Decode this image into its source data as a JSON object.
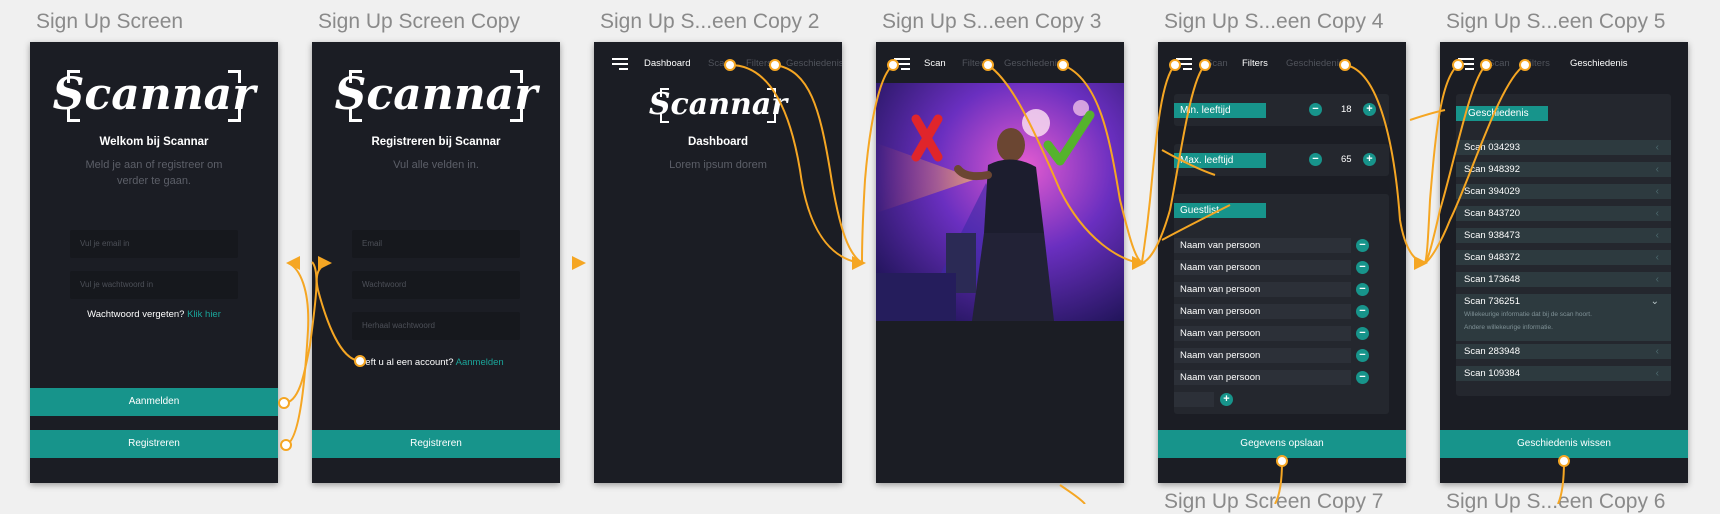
{
  "frames": [
    {
      "title": "Sign Up Screen"
    },
    {
      "title": "Sign Up Screen Copy"
    },
    {
      "title": "Sign Up S...een Copy 2"
    },
    {
      "title": "Sign Up S...een Copy 3"
    },
    {
      "title": "Sign Up S...een Copy 4"
    },
    {
      "title": "Sign Up S...een Copy 5"
    }
  ],
  "bottom_titles": [
    "Sign Up Screen Copy 7",
    "Sign Up S...een Copy 6"
  ],
  "logo_text": "Scannar",
  "login": {
    "heading": "Welkom bij Scannar",
    "subtitle": "Meld je aan of registreer om verder te gaan.",
    "email_placeholder": "Vul je email in",
    "password_placeholder": "Vul je wachtwoord in",
    "forgot_text": "Wachtwoord vergeten?",
    "forgot_link": "Klik hier",
    "login_button": "Aanmelden",
    "register_button": "Registreren"
  },
  "register": {
    "heading": "Registreren bij Scannar",
    "subtitle": "Vul alle velden in.",
    "email_placeholder": "Email",
    "password_placeholder": "Wachtwoord",
    "repeat_placeholder": "Herhaal wachtwoord",
    "account_text": "eeft u al een account?",
    "account_link": "Aanmelden",
    "register_button": "Registreren"
  },
  "dashboard": {
    "nav": [
      "Dashboard",
      "Scan",
      "Filters",
      "Geschiedenis"
    ],
    "heading": "Dashboard",
    "subtitle": "Lorem ipsum dorem"
  },
  "scan": {
    "nav": [
      "Scan",
      "Filters",
      "Geschiedenis"
    ]
  },
  "filters": {
    "nav": [
      "Scan",
      "Filters",
      "Geschiedenis"
    ],
    "min_label": "Min. leeftijd",
    "min_value": "18",
    "max_label": "Max. leeftijd",
    "max_value": "65",
    "guestlist_label": "Guestlist",
    "guests": [
      "Naam van persoon",
      "Naam van persoon",
      "Naam van persoon",
      "Naam van persoon",
      "Naam van persoon",
      "Naam van persoon",
      "Naam van persoon"
    ],
    "save_button": "Gegevens opslaan"
  },
  "history": {
    "nav": [
      "Scan",
      "Filters",
      "Geschiedenis"
    ],
    "label": "Geschiedenis",
    "scans": [
      "Scan 034293",
      "Scan 948392",
      "Scan 394029",
      "Scan 843720",
      "Scan 938473",
      "Scan 948372",
      "Scan 173648"
    ],
    "expanded_scan": "Scan 736251",
    "expanded_info_1": "Willekeurige informatie dat bij de scan hoort.",
    "expanded_info_2": "Andere willekeurige informatie.",
    "more_scans": [
      "Scan 283948",
      "Scan 109384"
    ],
    "clear_button": "Geschiedenis wissen"
  },
  "colors": {
    "accent": "#17948b",
    "wire": "#f5a623",
    "screen_bg": "#1b1d24",
    "canvas": "#f0f0f0"
  }
}
